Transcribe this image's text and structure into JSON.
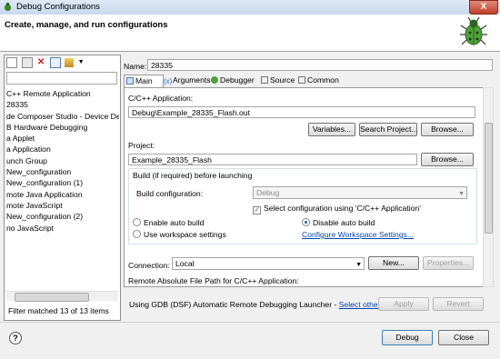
{
  "window": {
    "title": "Debug Configurations",
    "close_label": "X"
  },
  "banner": {
    "heading": "Create, manage, and run configurations"
  },
  "left": {
    "toolbar_icons": [
      "new-configuration-icon",
      "duplicate-icon",
      "delete-icon",
      "collapse-all-icon",
      "filter-icon",
      "menu-chevron-icon"
    ],
    "tree_items": [
      "C++ Remote Application",
      "28335",
      "de Composer Studio - Device De",
      "B Hardware Debugging",
      "a Applet",
      "a Application",
      "unch Group",
      "New_configuration",
      "New_configuration (1)",
      "mote Java Application",
      "mote JavaScript",
      "New_configuration (2)",
      "no JavaScript"
    ],
    "selected_index": 1,
    "status": "Filter matched 13 of 13 items"
  },
  "right": {
    "name_label": "Name:",
    "name_value": "28335",
    "tabs": [
      {
        "label": "Main",
        "icon": "main-tab-icon"
      },
      {
        "label": "Arguments",
        "icon": "arguments-tab-icon"
      },
      {
        "label": "Debugger",
        "icon": "debugger-tab-icon"
      },
      {
        "label": "Source",
        "icon": "source-tab-icon"
      },
      {
        "label": "Common",
        "icon": "common-tab-icon"
      }
    ],
    "app_label": "C/C++ Application:",
    "app_value": "Debug\\Example_28335_Flash.out",
    "variables_btn": "Variables...",
    "search_project_btn": "Search Project...",
    "browse_btn": "Browse...",
    "project_label": "Project:",
    "project_value": "Example_28335_Flash",
    "build_group_label": "Build (if required) before launching",
    "build_config_label": "Build configuration:",
    "build_config_value": "Debug",
    "select_config_label": "Select configuration using 'C/C++ Application'",
    "select_config_checked": true,
    "enable_auto_build": "Enable auto build",
    "disable_auto_build": "Disable auto build",
    "use_workspace": "Use workspace settings",
    "configure_workspace": "Configure Workspace Settings...",
    "connection_label": "Connection:",
    "connection_value": "Local",
    "new_btn": "New...",
    "properties_btn": "Properties...",
    "remote_path_label": "Remote Absolute File Path for C/C++ Application:",
    "launcher_text": "Using GDB (DSF) Automatic Remote Debugging Launcher - ",
    "select_other": "Select other...",
    "apply_btn": "Apply",
    "revert_btn": "Revert"
  },
  "footer": {
    "help_label": "?",
    "debug_btn": "Debug",
    "close_btn": "Close"
  }
}
